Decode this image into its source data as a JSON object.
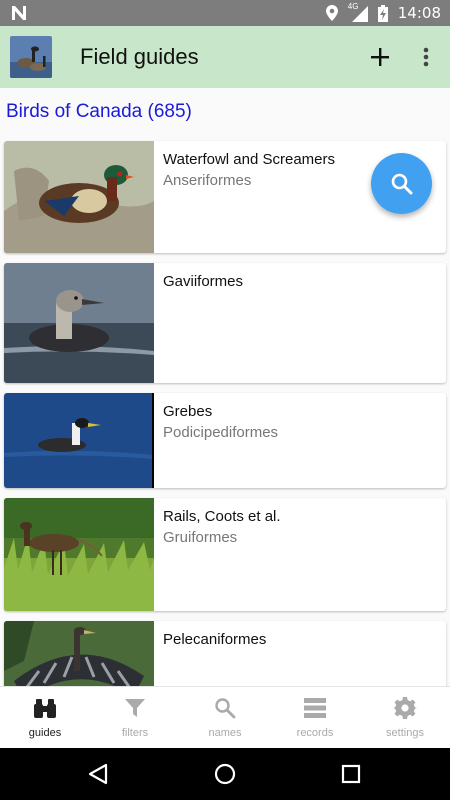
{
  "status_bar": {
    "time": "14:08",
    "network": "4G"
  },
  "app_bar": {
    "title": "Field guides",
    "add_icon": "plus-icon",
    "more_icon": "more-vert-icon"
  },
  "section": {
    "title": "Birds of Canada (685)"
  },
  "groups": [
    {
      "name": "Waterfowl and Screamers",
      "latin": "Anseriformes"
    },
    {
      "name": "Gaviiformes",
      "latin": ""
    },
    {
      "name": "Grebes",
      "latin": "Podicipediformes"
    },
    {
      "name": "Rails, Coots et al.",
      "latin": "Gruiformes"
    },
    {
      "name": "Pelecaniformes",
      "latin": ""
    }
  ],
  "fab": {
    "icon": "search-icon"
  },
  "bottom_nav": [
    {
      "label": "guides",
      "icon": "binoculars-icon",
      "active": true
    },
    {
      "label": "filters",
      "icon": "filter-icon",
      "active": false
    },
    {
      "label": "names",
      "icon": "search-icon",
      "active": false
    },
    {
      "label": "records",
      "icon": "list-icon",
      "active": false
    },
    {
      "label": "settings",
      "icon": "gear-icon",
      "active": false
    }
  ],
  "colors": {
    "app_bar": "#c8e6c9",
    "section_title": "#1a1adb",
    "fab": "#42a0f0",
    "status_bar": "#7d7d7d"
  }
}
